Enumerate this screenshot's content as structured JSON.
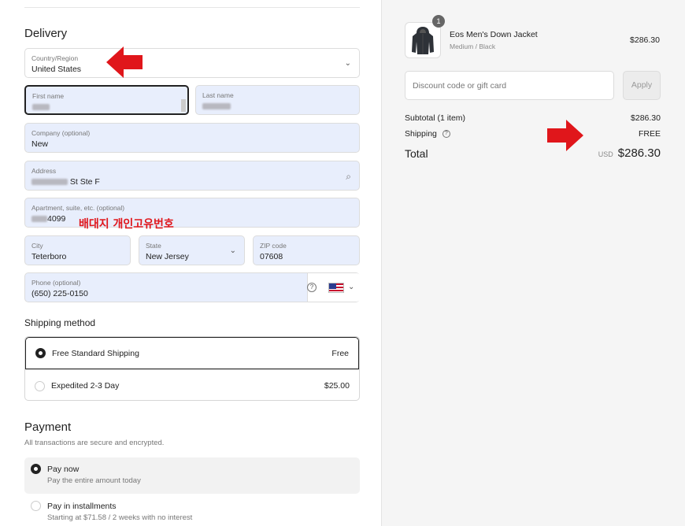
{
  "delivery": {
    "heading": "Delivery",
    "country": {
      "label": "Country/Region",
      "value": "United States"
    },
    "first_name": {
      "label": "First name"
    },
    "last_name": {
      "label": "Last name"
    },
    "company": {
      "label": "Company (optional)",
      "value": "New"
    },
    "address": {
      "label": "Address",
      "value": "St Ste F"
    },
    "apartment": {
      "label": "Apartment, suite, etc. (optional)",
      "value": "4099"
    },
    "city": {
      "label": "City",
      "value": "Teterboro"
    },
    "state": {
      "label": "State",
      "value": "New Jersey"
    },
    "zip": {
      "label": "ZIP code",
      "value": "07608"
    },
    "phone": {
      "label": "Phone (optional)",
      "value": "(650) 225-0150"
    },
    "annotation": "배대지 개인고유번호"
  },
  "shipping": {
    "heading": "Shipping method",
    "options": [
      {
        "name": "Free Standard Shipping",
        "price": "Free",
        "selected": true
      },
      {
        "name": "Expedited 2-3 Day",
        "price": "$25.00",
        "selected": false
      }
    ]
  },
  "payment": {
    "heading": "Payment",
    "subtitle": "All transactions are secure and encrypted.",
    "options": [
      {
        "title": "Pay now",
        "desc": "Pay the entire amount today",
        "selected": true
      },
      {
        "title": "Pay in installments",
        "desc": "Starting at $71.58 / 2 weeks with no interest",
        "selected": false
      }
    ]
  },
  "summary": {
    "item": {
      "qty": "1",
      "name": "Eos Men's Down Jacket",
      "variant": "Medium / Black",
      "price": "$286.30"
    },
    "discount_placeholder": "Discount code or gift card",
    "apply_label": "Apply",
    "subtotal_label": "Subtotal (1 item)",
    "subtotal_value": "$286.30",
    "shipping_label": "Shipping",
    "shipping_value": "FREE",
    "total_label": "Total",
    "total_currency": "USD",
    "total_value": "$286.30"
  },
  "colors": {
    "annotation_red": "#e0161b",
    "autofill_blue": "#e8eefc"
  }
}
